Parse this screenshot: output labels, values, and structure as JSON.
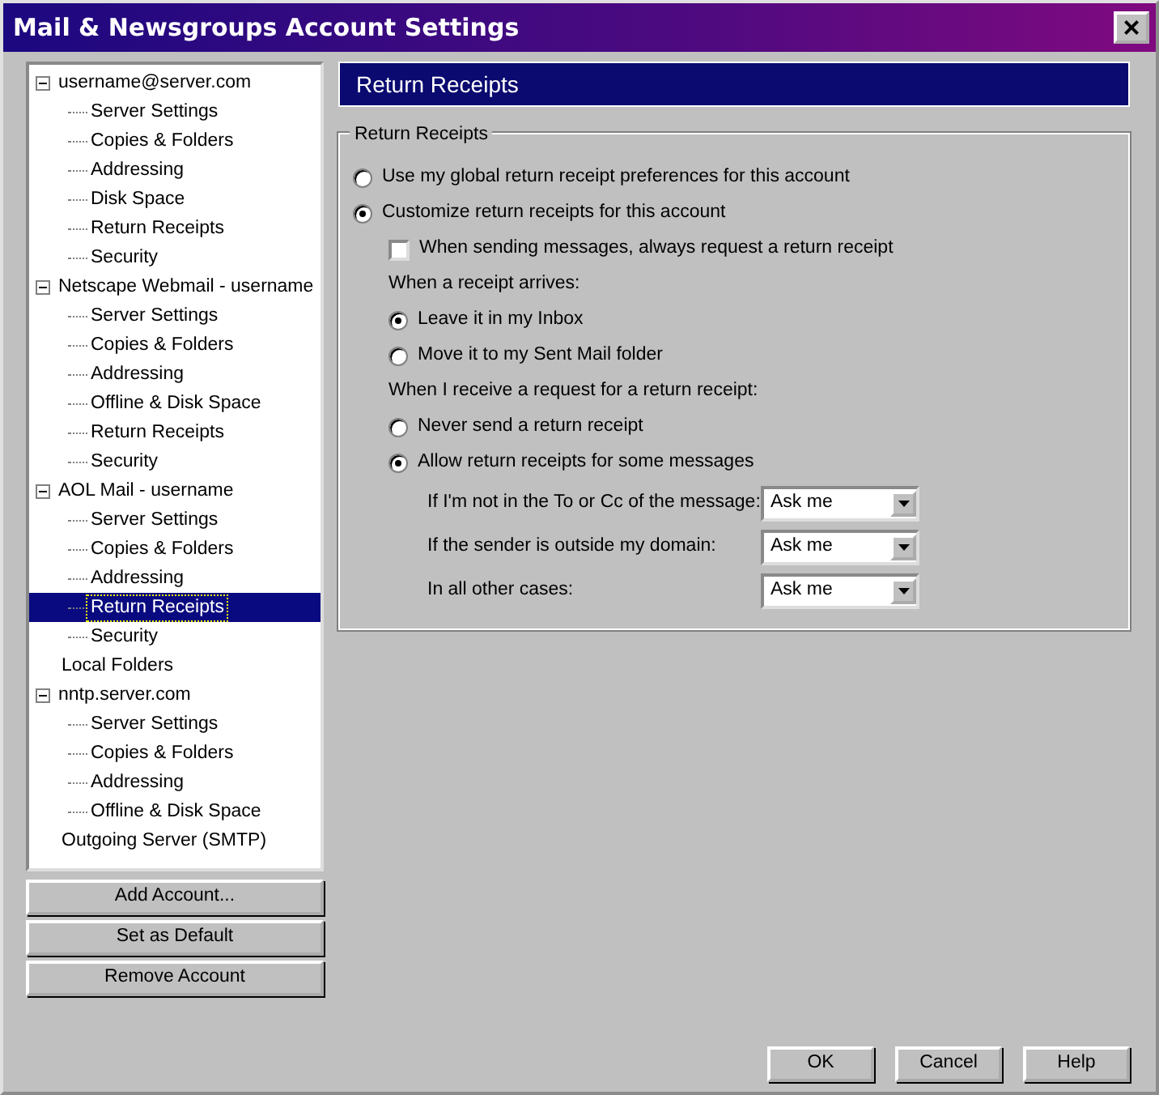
{
  "window": {
    "title": "Mail & Newsgroups Account Settings",
    "close": "×"
  },
  "tree": [
    {
      "label": "username@server.com",
      "expanded": true,
      "selected": false,
      "children": [
        {
          "label": "Server Settings",
          "selected": false
        },
        {
          "label": "Copies & Folders",
          "selected": false
        },
        {
          "label": "Addressing",
          "selected": false
        },
        {
          "label": "Disk Space",
          "selected": false
        },
        {
          "label": "Return Receipts",
          "selected": false
        },
        {
          "label": "Security",
          "selected": false
        }
      ]
    },
    {
      "label": "Netscape Webmail - username",
      "expanded": true,
      "selected": false,
      "children": [
        {
          "label": "Server Settings",
          "selected": false
        },
        {
          "label": "Copies & Folders",
          "selected": false
        },
        {
          "label": "Addressing",
          "selected": false
        },
        {
          "label": "Offline & Disk Space",
          "selected": false
        },
        {
          "label": "Return Receipts",
          "selected": false
        },
        {
          "label": "Security",
          "selected": false
        }
      ]
    },
    {
      "label": "AOL Mail - username",
      "expanded": true,
      "selected": false,
      "children": [
        {
          "label": "Server Settings",
          "selected": false
        },
        {
          "label": "Copies & Folders",
          "selected": false
        },
        {
          "label": "Addressing",
          "selected": false
        },
        {
          "label": "Return Receipts",
          "selected": true
        },
        {
          "label": "Security",
          "selected": false
        }
      ]
    },
    {
      "label": "Local Folders",
      "selected": false
    },
    {
      "label": "nntp.server.com",
      "expanded": true,
      "selected": false,
      "children": [
        {
          "label": "Server Settings",
          "selected": false
        },
        {
          "label": "Copies & Folders",
          "selected": false
        },
        {
          "label": "Addressing",
          "selected": false
        },
        {
          "label": "Offline & Disk Space",
          "selected": false
        }
      ]
    },
    {
      "label": "Outgoing Server (SMTP)",
      "selected": false
    }
  ],
  "account_buttons": [
    "Add Account...",
    "Set as Default",
    "Remove Account"
  ],
  "panel": {
    "heading": "Return Receipts",
    "legend": "Return Receipts",
    "scope_options": [
      {
        "label": "Use my global return receipt preferences for this account",
        "selected": false
      },
      {
        "label": "Customize return receipts for this account",
        "selected": true
      }
    ],
    "always_request": {
      "label": "When sending messages, always request a return receipt",
      "checked": false
    },
    "arrival_label": "When a receipt arrives:",
    "arrival_options": [
      {
        "label": "Leave it in my Inbox",
        "selected": true
      },
      {
        "label": "Move it to my Sent Mail folder",
        "selected": false
      }
    ],
    "request_label": "When I receive a request for a return receipt:",
    "request_options": [
      {
        "label": "Never send a return receipt",
        "selected": false
      },
      {
        "label": "Allow return receipts for some messages",
        "selected": true
      }
    ],
    "rules": [
      {
        "label": "If I'm not in the To or Cc of the message:",
        "value": "Ask me"
      },
      {
        "label": "If the sender is outside my domain:",
        "value": "Ask me"
      },
      {
        "label": "In all other cases:",
        "value": "Ask me"
      }
    ]
  },
  "dialog_buttons": [
    "OK",
    "Cancel",
    "Help"
  ]
}
